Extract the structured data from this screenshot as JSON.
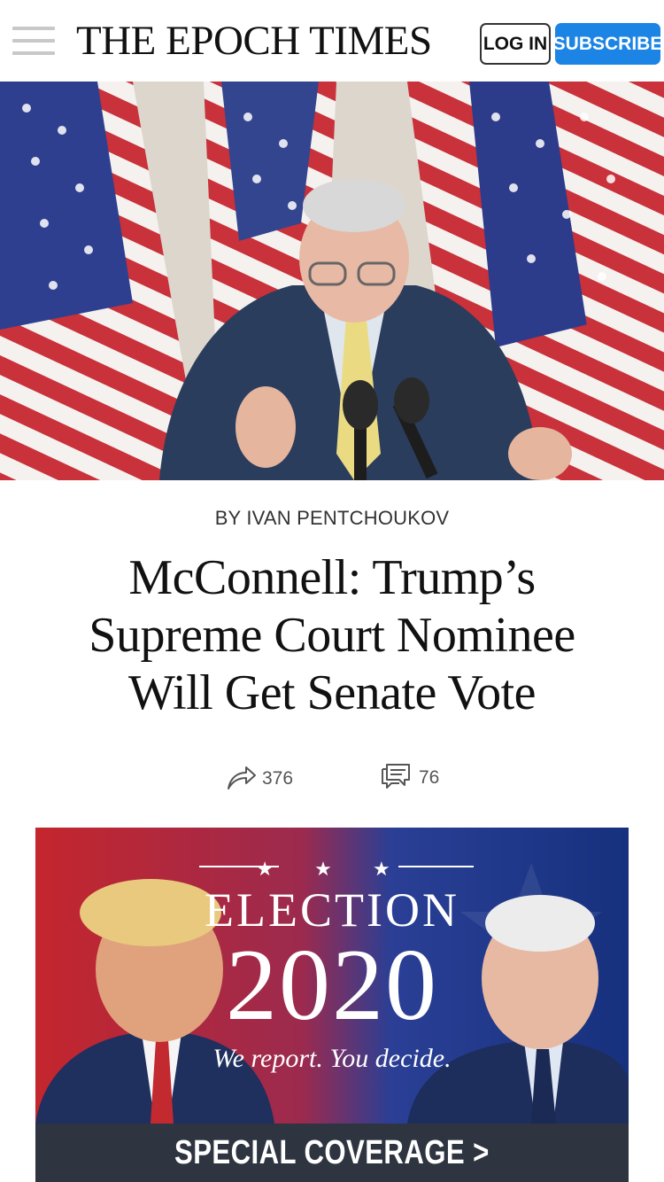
{
  "header": {
    "logo": "THE EPOCH TIMES",
    "login_label": "LOG IN",
    "subscribe_label": "SUBSCRIBE",
    "accent_color": "#1b84e4"
  },
  "article": {
    "byline": "BY IVAN PENTCHOUKOV",
    "headline": "McConnell: Trump’s Supreme Court Nominee Will Get Senate Vote",
    "share_count": "376",
    "comment_count": "76",
    "share_icon": "share-arrow-icon",
    "comment_icon": "comment-icon"
  },
  "banner": {
    "stars": "★ ★ ★",
    "title": "ELECTION",
    "year": "2020",
    "tagline": "We report. You decide.",
    "cta": "SPECIAL COVERAGE >"
  }
}
